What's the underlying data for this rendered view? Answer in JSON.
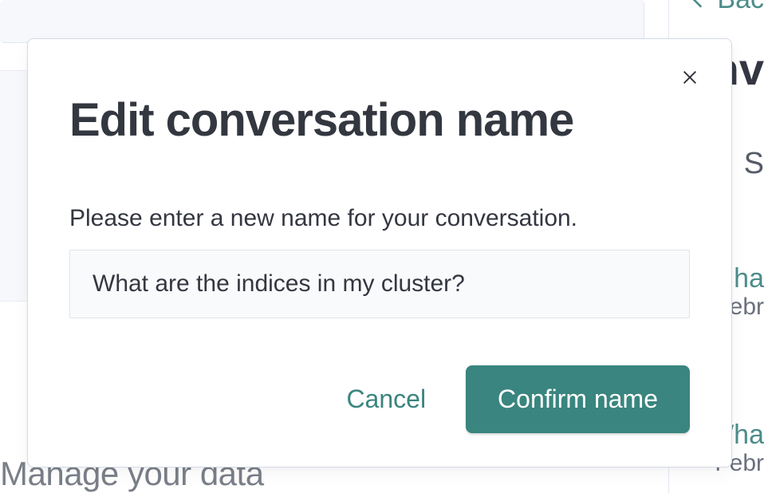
{
  "modal": {
    "title": "Edit conversation name",
    "description": "Please enter a new name for your conversation.",
    "input_value": "What are the indices in my cluster?",
    "cancel_label": "Cancel",
    "confirm_label": "Confirm name"
  },
  "background": {
    "back_label": "Bac",
    "heading_fragment": "nv",
    "s_fragment": "S",
    "link_fragment_1": "ha",
    "date_fragment_1": "Febr",
    "link_fragment_2": "Wha",
    "date_fragment_2": "Febr",
    "manage_text": "Manage your data"
  }
}
